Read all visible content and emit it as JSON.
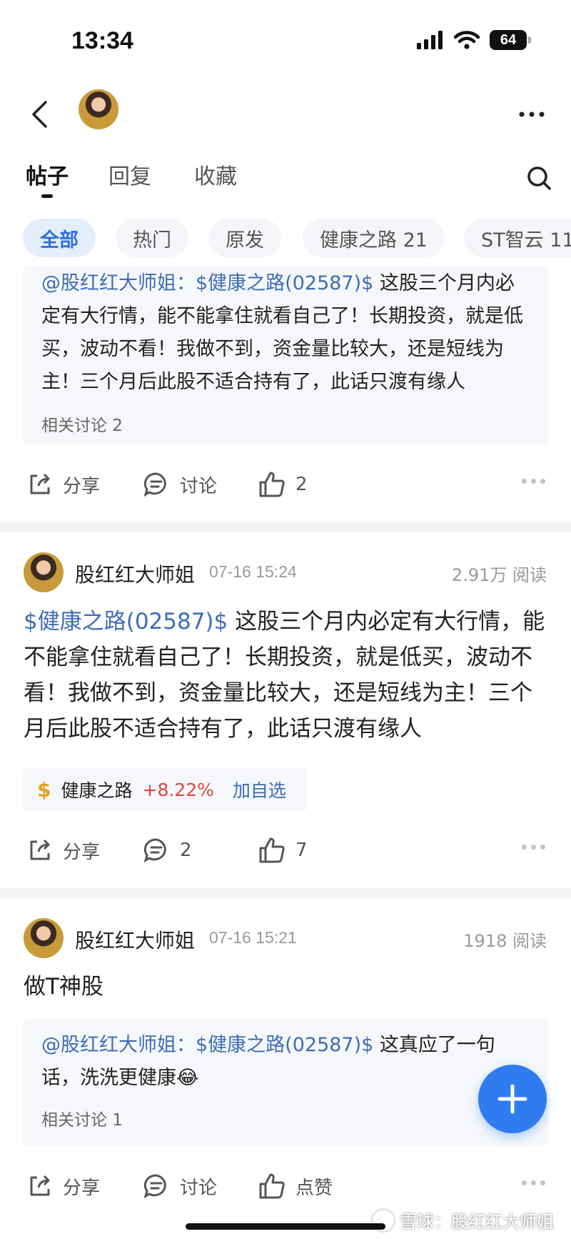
{
  "status_bar": {
    "time": "13:34",
    "battery": "64"
  },
  "tabs": [
    {
      "label": "帖子"
    },
    {
      "label": "回复"
    },
    {
      "label": "收藏"
    }
  ],
  "filters": [
    {
      "label": "全部"
    },
    {
      "label": "热门"
    },
    {
      "label": "原发"
    },
    {
      "label": "健康之路 21"
    },
    {
      "label": "ST智云 11"
    }
  ],
  "first_item": {
    "quote": {
      "mention": "@股红红大师姐：",
      "stock_link": "$健康之路(02587)$",
      "text": " 这股三个月内必定有大行情，能不能拿住就看自己了！长期投资，就是低买，波动不看！我做不到，资金量比较大，还是短线为主！三个月后此股不适合持有了，此话只渡有缘人",
      "meta": "相关讨论 2"
    },
    "actions": {
      "share": "分享",
      "comment": "讨论",
      "like": "2"
    }
  },
  "posts": [
    {
      "author": "股红红大师姐",
      "time": "07-16 15:24",
      "reads": "2.91万 阅读",
      "stock_link": "$健康之路(02587)$",
      "text": " 这股三个月内必定有大行情，能不能拿住就看自己了！长期投资，就是低买，波动不看！我做不到，资金量比较大，还是短线为主！三个月后此股不适合持有了，此话只渡有缘人",
      "stock_card": {
        "symbol": "$",
        "name": "健康之路",
        "change": "+8.22%",
        "watch": "加自选"
      },
      "actions": {
        "share": "分享",
        "comment": "2",
        "like": "7"
      }
    },
    {
      "author": "股红红大师姐",
      "time": "07-16 15:21",
      "reads": "1918 阅读",
      "text": "做T神股",
      "quote": {
        "mention": "@股红红大师姐：",
        "stock_link": "$健康之路(02587)$",
        "text": " 这真应了一句话，洗洗更健康😂",
        "meta": "相关讨论 1"
      },
      "actions": {
        "share": "分享",
        "comment": "讨论",
        "like": "点赞"
      }
    }
  ],
  "watermark": "雪球：股红红大师姐",
  "colors": {
    "accent": "#2f7cf0",
    "link": "#3e6db5",
    "up": "#d9493b",
    "dollar": "#e6a118"
  }
}
